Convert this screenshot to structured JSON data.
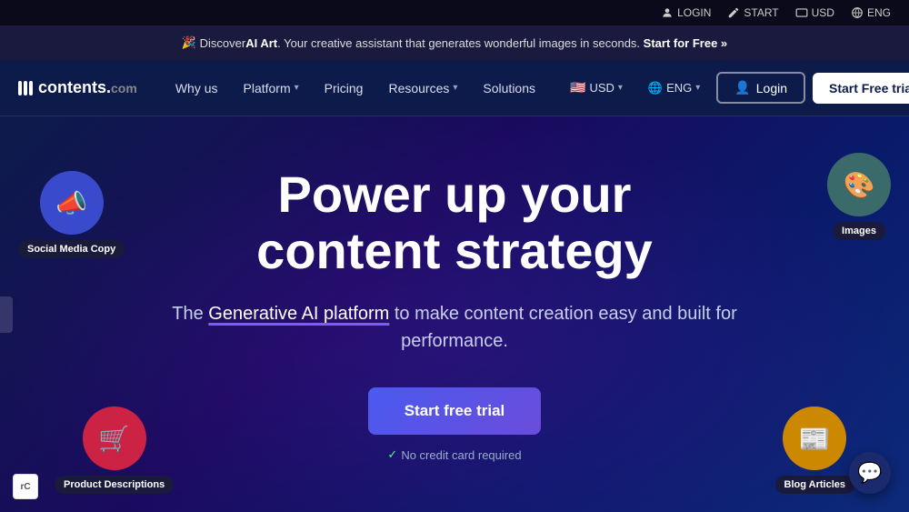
{
  "utility_bar": {
    "login_label": "LOGIN",
    "start_label": "START",
    "usd_label": "USD",
    "eng_label": "ENG"
  },
  "announcement": {
    "emoji": "🎉",
    "text_pre": "Discover ",
    "highlight": "AI Art",
    "text_post": ". Your creative assistant that generates wonderful images in seconds.",
    "cta": "Start for Free »"
  },
  "navbar": {
    "logo_text": "contents.",
    "logo_suffix": "com",
    "why_us": "Why us",
    "platform": "Platform",
    "pricing": "Pricing",
    "resources": "Resources",
    "solutions": "Solutions",
    "currency": "USD",
    "language": "ENG",
    "login": "Login",
    "start_trial": "Start Free trial"
  },
  "hero": {
    "title_line1": "Power up your",
    "title_line2": "content strategy",
    "subtitle_pre": "The ",
    "subtitle_link": "Generative AI platform",
    "subtitle_post": " to make content creation easy and built for performance.",
    "cta_button": "Start free trial",
    "no_credit": "No credit card required"
  },
  "badges": {
    "social_media": {
      "label": "Social Media Copy",
      "icon": "📣"
    },
    "product_descriptions": {
      "label": "Product Descriptions",
      "icon": "🛒"
    },
    "images": {
      "label": "Images",
      "icon": "🎨"
    },
    "blog_articles": {
      "label": "Blog Articles",
      "icon": "📰"
    }
  }
}
